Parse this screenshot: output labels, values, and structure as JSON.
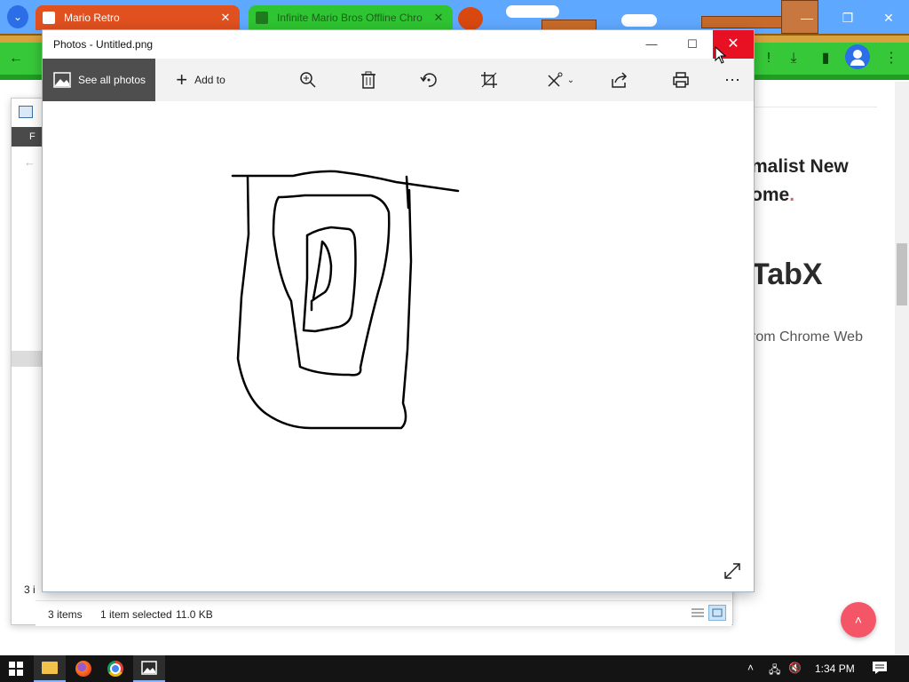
{
  "browser": {
    "tabs": [
      {
        "label": "Mario Retro",
        "favicon_color": "#e86a3c"
      },
      {
        "label": "Infinite Mario Bros Offline Chro",
        "favicon_color": "#2a8a2a"
      }
    ],
    "colors": {
      "accent": "#2b6ee8",
      "tab1": "#e0511f",
      "tab2": "#2fc431"
    }
  },
  "page": {
    "heading_line1": "malist New",
    "heading_line2": "ome",
    "heading_dot": ".",
    "logo_text": "TabX",
    "sub_text": "rom Chrome Web",
    "fab_icon": "chevron-up-icon"
  },
  "explorer": {
    "status_items": "3 items",
    "status_selected": "1 item selected",
    "status_size": "11.0 KB",
    "left_peek_letter": "F",
    "left_peek_count": "3 i"
  },
  "photos": {
    "title": "Photos - Untitled.png",
    "toolbar": {
      "see_all": "See all photos",
      "add_to": "Add to"
    },
    "icons": [
      "zoom-icon",
      "delete-icon",
      "rotate-icon",
      "crop-icon",
      "edit-icon",
      "share-icon",
      "print-icon",
      "more-icon",
      "fullscreen-icon"
    ]
  },
  "taskbar": {
    "time": "1:34 PM",
    "apps": [
      "file-explorer",
      "firefox",
      "chrome",
      "photos"
    ]
  }
}
